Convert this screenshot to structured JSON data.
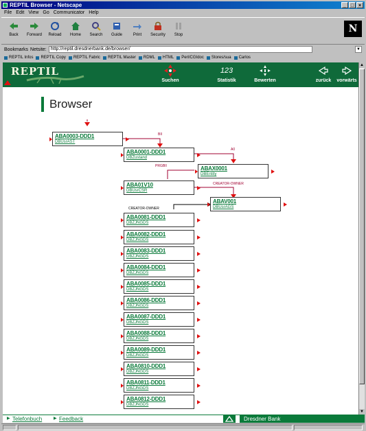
{
  "window": {
    "title": "REPTIL Browser - Netscape"
  },
  "menu": [
    "File",
    "Edit",
    "View",
    "Go",
    "Communicator",
    "Help"
  ],
  "toolbar": {
    "buttons": [
      {
        "label": "Back",
        "icon": "back-arrow-icon"
      },
      {
        "label": "Forward",
        "icon": "forward-arrow-icon"
      },
      {
        "label": "Reload",
        "icon": "reload-icon"
      },
      {
        "label": "Home",
        "icon": "home-icon"
      },
      {
        "label": "Search",
        "icon": "search-icon"
      },
      {
        "label": "Guide",
        "icon": "guide-icon"
      },
      {
        "label": "Print",
        "icon": "print-icon"
      },
      {
        "label": "Security",
        "icon": "security-lock-icon"
      },
      {
        "label": "Stop",
        "icon": "stop-icon"
      }
    ],
    "logo": "N"
  },
  "location": {
    "bookmarks_label": "Bookmarks",
    "netsite_label": "Netsite:",
    "url": "http://reptil.dresdnerbank.de/browser/"
  },
  "bookmarks_bar": [
    "REPTIL Infos",
    "REPTIL Copy",
    "REPTIL Fabric",
    "REPTIL Master",
    "RDML",
    "HTML",
    "Perl/CGIdoc",
    "Stores/sua",
    "Carlos"
  ],
  "banner": {
    "logo_text": "REPTIL",
    "nav": [
      {
        "label": "Suchen",
        "icon": "crosshair-search-icon"
      },
      {
        "label": "Statistik",
        "icon": "statistics-123-icon"
      },
      {
        "label": "Bewerten",
        "icon": "arrows-rate-icon"
      },
      {
        "label": "zurück",
        "icon": "back-arrow-icon"
      },
      {
        "label": "vorwärts",
        "icon": "forward-arrow-icon"
      }
    ]
  },
  "page": {
    "title": "Browser"
  },
  "nodes": [
    {
      "id": "ABA0003-DDD1",
      "sub": "DBUsrAST"
    },
    {
      "id": "ABA0001-DDD1",
      "sub": "DBZustand"
    },
    {
      "id": "ABAX0001",
      "sub": "DBEntity"
    },
    {
      "id": "ABA01V10",
      "sub": "DBUsrCSR"
    },
    {
      "id": "ABAV001",
      "sub": "DBUsrAGS"
    },
    {
      "id": "ABA0081-DDD1",
      "sub": "DBZJNGDS"
    },
    {
      "id": "ABA0082-DDD1",
      "sub": "DBZJNGDS"
    },
    {
      "id": "ABA0083-DDD1",
      "sub": "DBZJNGDS"
    },
    {
      "id": "ABA0084-DDD1",
      "sub": "DBZJNGDS"
    },
    {
      "id": "ABA0085-DDD1",
      "sub": "DBZJNGDS"
    },
    {
      "id": "ABA0086-DDD1",
      "sub": "DBZJNGDS"
    },
    {
      "id": "ABA0087-DDD1",
      "sub": "DBZJNGDS"
    },
    {
      "id": "ABA0088-DDD1",
      "sub": "DBZJNGDS"
    },
    {
      "id": "ABA0089-DDD1",
      "sub": "DBZJNGDS"
    },
    {
      "id": "ABA0810-DDD1",
      "sub": "DBZJNGDS"
    },
    {
      "id": "ABA0811-DDD1",
      "sub": "DBZJNGDS"
    },
    {
      "id": "ABA0812-DDD1",
      "sub": "DBZJNGDS"
    }
  ],
  "links": {
    "l1": "BII",
    "l2": "A0",
    "l3": "PRGBII",
    "l4": "CREATOR-OWNER",
    "l5": "CREATOR-OWNER"
  },
  "footer": {
    "link1": "Telefonbuch",
    "link2": "Feedback",
    "bank": "Dresdner Bank"
  },
  "colors": {
    "brand_green": "#0a7a3a",
    "banner_green": "#0f6a3a",
    "arrow_red": "#e01010",
    "link_label": "#a00030"
  }
}
